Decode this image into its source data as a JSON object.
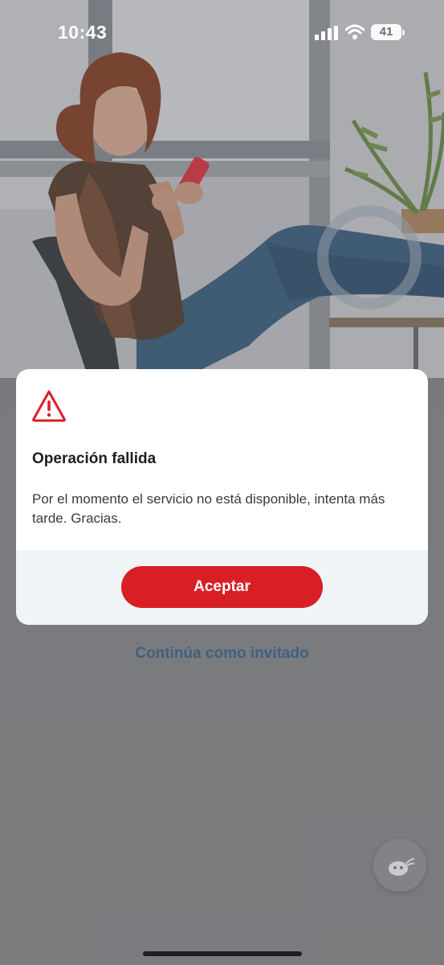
{
  "status_bar": {
    "time": "10:43",
    "battery_level": "41"
  },
  "modal": {
    "icon": "warning-triangle-icon",
    "title": "Operación fallida",
    "message": "Por el momento el servicio no está disponible, intenta más tarde. Gracias.",
    "accept_label": "Aceptar"
  },
  "background": {
    "guest_link": "Continúa como invitado",
    "chat_icon": "chatbot-icon"
  },
  "colors": {
    "brand_red": "#d81f25",
    "link_blue": "#3f6c94",
    "footer_bg": "#f0f4f7"
  }
}
